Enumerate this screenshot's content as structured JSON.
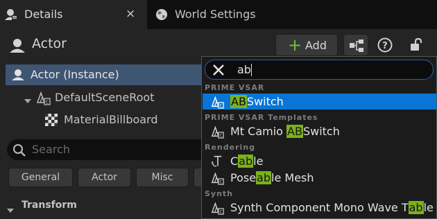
{
  "tabs": [
    {
      "label": "Details",
      "icon": "details-icon",
      "close": "×"
    },
    {
      "label": "World Settings",
      "icon": "globe-icon"
    }
  ],
  "header": {
    "title": "Actor",
    "add_label": "Add",
    "icons": [
      "blueprint-icon",
      "help-icon",
      "unlock-icon"
    ]
  },
  "tree": {
    "items": [
      {
        "label": "Actor (Instance)",
        "selected": true
      },
      {
        "label": "DefaultSceneRoot",
        "expanded": true
      },
      {
        "label": "MaterialBillboard"
      }
    ]
  },
  "details_search": {
    "placeholder": "Search"
  },
  "filters": [
    "General",
    "Actor",
    "Misc"
  ],
  "section": {
    "title": "Transform",
    "expanded": true
  },
  "dropdown": {
    "query": "ab",
    "categories": [
      {
        "name": "PRIME VSAR",
        "items": [
          {
            "pre": "",
            "match": "AB",
            "post": "Switch",
            "selected": true
          }
        ]
      },
      {
        "name": "PRIME VSAR Templates",
        "items": [
          {
            "pre": "Mt Camio ",
            "match": "AB",
            "post": "Switch"
          }
        ]
      },
      {
        "name": "Rendering",
        "items": [
          {
            "pre": "C",
            "match": "ab",
            "post": "le"
          },
          {
            "pre": "Pose",
            "match": "ab",
            "post": "le Mesh"
          }
        ]
      },
      {
        "name": "Synth",
        "items": [
          {
            "pre": "Synth Component Mono Wave T",
            "match": "ab",
            "post": "le"
          }
        ]
      }
    ]
  },
  "colors": {
    "panel_bg": "#242424",
    "selection_blue": "#0a75d6",
    "tree_selection": "#3f5672",
    "match_highlight": "#7bb21b",
    "add_plus_green": "#6fc23a",
    "search_focus_border": "#2f5fa8"
  }
}
